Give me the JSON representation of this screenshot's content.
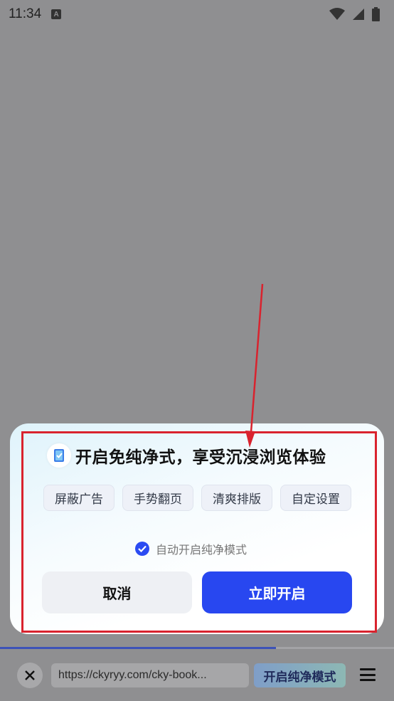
{
  "status_bar": {
    "time": "11:34",
    "notification_icon": "a-icon",
    "icons": [
      "wifi-icon",
      "cellular-signal-icon",
      "battery-icon"
    ]
  },
  "dialog": {
    "app_icon": "book-icon",
    "title": "开启免纯净式，享受沉浸浏览体验",
    "features": [
      "屏蔽广告",
      "手势翻页",
      "清爽排版",
      "自定设置"
    ],
    "auto_enable": {
      "label": "自动开启纯净模式",
      "checked": true
    },
    "cancel_label": "取消",
    "confirm_label": "立即开启"
  },
  "browser_bar": {
    "load_progress_percent": 70,
    "url": "https://ckyryy.com/cky-book...",
    "pure_mode_label": "开启纯净模式",
    "close_icon": "close-icon",
    "menu_icon": "menu-icon"
  },
  "colors": {
    "accent": "#2847f0",
    "overlay": "#8f8f91",
    "annotation": "#d9232e"
  }
}
